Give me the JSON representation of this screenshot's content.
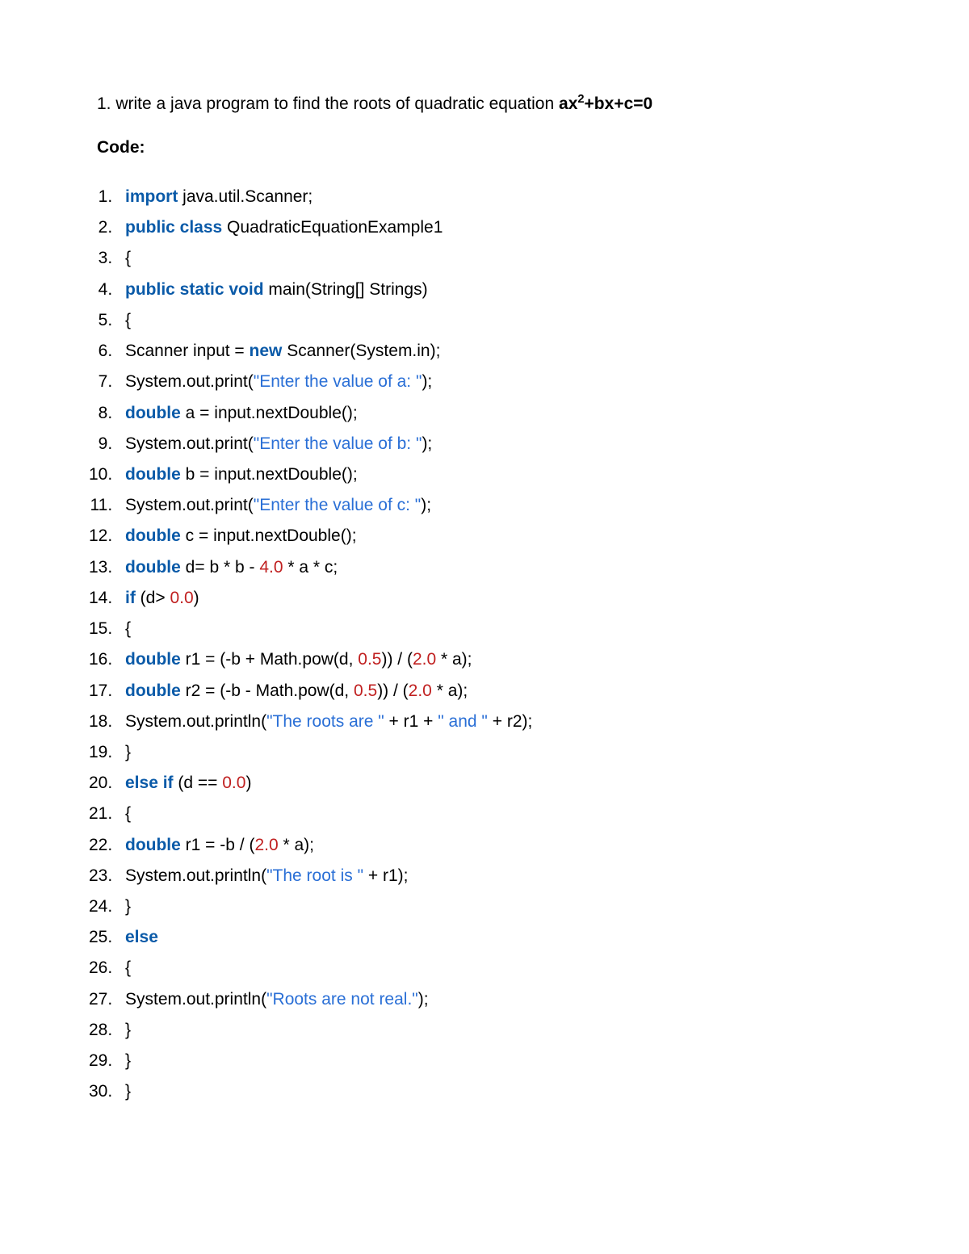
{
  "prompt_num": "1.",
  "prompt_text": "write a java program to find the roots of quadratic equation",
  "equation_lhs": "ax",
  "equation_sup": "2",
  "equation_rest": "+bx+c=0",
  "code_label": "Code:",
  "code": {
    "l1": {
      "kw": "import",
      "rest": " java.util.Scanner;"
    },
    "l2": {
      "kw": "public class",
      "rest": " QuadraticEquationExample1"
    },
    "l3": "{",
    "l4": {
      "kw": "public static void",
      "rest": " main(String[] Strings)"
    },
    "l5": "{",
    "l6": {
      "a": "Scanner input = ",
      "kw": "new",
      "b": " Scanner(System.in);"
    },
    "l7": {
      "a": "System.out.print(",
      "str": "\"Enter the value of a: \"",
      "b": ");"
    },
    "l8": {
      "kw": "double",
      "rest": " a = input.nextDouble();"
    },
    "l9": {
      "a": "System.out.print(",
      "str": "\"Enter the value of b: \"",
      "b": ");"
    },
    "l10": {
      "kw": "double",
      "rest": " b = input.nextDouble();"
    },
    "l11": {
      "a": "System.out.print(",
      "str": "\"Enter the value of c: \"",
      "b": ");"
    },
    "l12": {
      "kw": "double",
      "rest": " c = input.nextDouble();"
    },
    "l13": {
      "kw": "double",
      "a": " d= b * b - ",
      "num": "4.0",
      "b": " * a * c;"
    },
    "l14": {
      "kw": "if",
      "a": " (d> ",
      "num": "0.0",
      "b": ")"
    },
    "l15": "{",
    "l16": {
      "kw": "double",
      "a": " r1 = (-b + Math.pow(d, ",
      "num1": "0.5",
      "mid": ")) / (",
      "num2": "2.0",
      "b": " * a);"
    },
    "l17": {
      "kw": "double",
      "a": " r2 = (-b - Math.pow(d, ",
      "num1": "0.5",
      "mid": ")) / (",
      "num2": "2.0",
      "b": " * a);"
    },
    "l18": {
      "a": "System.out.println(",
      "str1": "\"The roots are \"",
      "mid": " + r1 + ",
      "str2": "\" and \"",
      "b": " + r2);"
    },
    "l19": "}",
    "l20": {
      "kw": "else if",
      "a": " (d == ",
      "num": "0.0",
      "b": ")"
    },
    "l21": "{",
    "l22": {
      "kw": "double",
      "a": " r1 = -b / (",
      "num": "2.0",
      "b": " * a);"
    },
    "l23": {
      "a": "System.out.println(",
      "str": "\"The root is \"",
      "b": " + r1);"
    },
    "l24": "}",
    "l25": {
      "kw": "else"
    },
    "l26": "{",
    "l27": {
      "a": "System.out.println(",
      "str": "\"Roots are not real.\"",
      "b": ");"
    },
    "l28": "}",
    "l29": "}",
    "l30": "}"
  }
}
